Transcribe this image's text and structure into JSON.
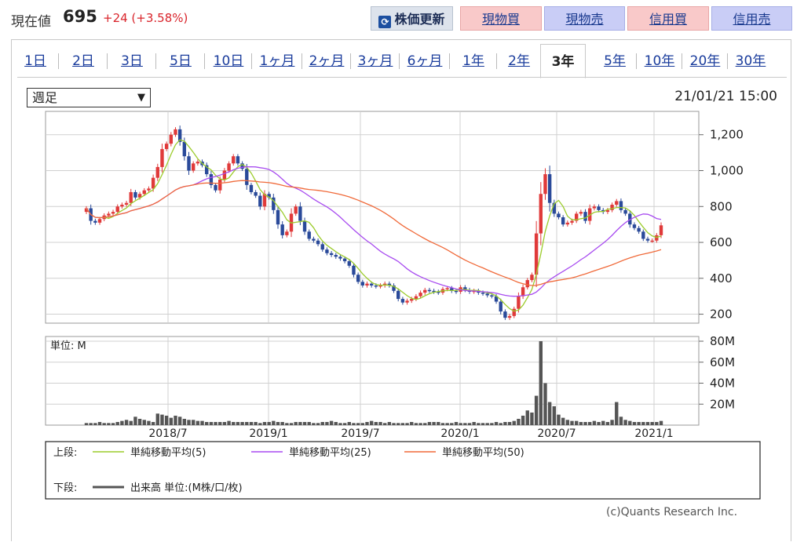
{
  "header": {
    "price_label": "現在値",
    "price_value": "695",
    "price_change": "+24 (+3.58%)",
    "refresh_label": "株価更新",
    "buttons": [
      "現物買",
      "現物売",
      "信用買",
      "信用売"
    ],
    "colors": {
      "up": "#d9242b",
      "buy_bg": "#f9c9c9",
      "sell_bg": "#c9cdf6"
    }
  },
  "tabs": [
    "1日",
    "2日",
    "3日",
    "5日",
    "10日",
    "1ヶ月",
    "2ヶ月",
    "3ヶ月",
    "6ヶ月",
    "1年",
    "2年",
    "3年",
    "5年",
    "10年",
    "20年",
    "30年"
  ],
  "active_tab": "3年",
  "controls": {
    "period_select": "週足",
    "datetime": "21/01/21 15:00"
  },
  "chart_data": {
    "type": "candlestick",
    "x_tick_labels": [
      "2018/7",
      "2019/1",
      "2019/7",
      "2020/1",
      "2020/7",
      "2021/1"
    ],
    "price_axis": {
      "ticks": [
        "200",
        "400",
        "600",
        "800",
        "1,000",
        "1,200"
      ],
      "range": [
        150,
        1330
      ]
    },
    "volume_axis": {
      "ticks": [
        "20M",
        "40M",
        "60M",
        "80M"
      ],
      "range": [
        0,
        80
      ],
      "unit_label": "単位: M"
    },
    "price_series_close": [
      790,
      720,
      710,
      730,
      750,
      760,
      770,
      800,
      810,
      820,
      880,
      850,
      870,
      890,
      900,
      960,
      1020,
      1120,
      1150,
      1200,
      1230,
      1160,
      1080,
      1000,
      1040,
      1050,
      1030,
      980,
      920,
      890,
      950,
      1000,
      1040,
      1080,
      1040,
      1010,
      920,
      880,
      860,
      800,
      870,
      850,
      780,
      700,
      640,
      660,
      760,
      800,
      720,
      660,
      620,
      610,
      590,
      560,
      540,
      530,
      520,
      510,
      495,
      470,
      420,
      380,
      360,
      370,
      360,
      355,
      360,
      370,
      360,
      330,
      285,
      265,
      275,
      285,
      300,
      320,
      335,
      330,
      325,
      320,
      340,
      345,
      330,
      325,
      350,
      335,
      325,
      330,
      320,
      315,
      305,
      300,
      270,
      215,
      180,
      190,
      230,
      300,
      350,
      390,
      420,
      650,
      870,
      980,
      820,
      760,
      740,
      700,
      710,
      720,
      760,
      770,
      720,
      790,
      800,
      780,
      770,
      780,
      810,
      830,
      780,
      760,
      700,
      680,
      660,
      620,
      610,
      610,
      640,
      695
    ],
    "ma_legend": [
      "単純移動平均(5)",
      "単純移動平均(25)",
      "単純移動平均(50)"
    ],
    "ma_colors": [
      "#9ccc2c",
      "#a84cf0",
      "#f06a3a"
    ],
    "volume_legend": "出来高 単位:(M株/口/枚)",
    "volume_values": [
      2,
      2,
      2,
      3,
      2,
      2,
      2,
      3,
      4,
      5,
      4,
      8,
      6,
      5,
      4,
      3,
      11,
      10,
      9,
      7,
      9,
      8,
      6,
      5,
      5,
      4,
      4,
      3,
      3,
      3,
      3,
      3,
      4,
      3,
      3,
      3,
      3,
      3,
      3,
      2,
      3,
      3,
      4,
      3,
      3,
      2,
      2,
      3,
      3,
      3,
      3,
      2,
      2,
      3,
      3,
      4,
      3,
      2,
      2,
      3,
      2,
      2,
      2,
      3,
      4,
      3,
      3,
      2,
      3,
      2,
      2,
      2,
      2,
      3,
      2,
      2,
      2,
      3,
      3,
      3,
      2,
      2,
      2,
      3,
      2,
      2,
      2,
      3,
      2,
      2,
      2,
      2,
      3,
      2,
      3,
      3,
      4,
      6,
      9,
      14,
      12,
      28,
      80,
      40,
      22,
      18,
      10,
      7,
      5,
      4,
      4,
      3,
      3,
      3,
      4,
      3,
      4,
      3,
      5,
      22,
      8,
      5,
      4,
      3,
      3,
      3,
      3,
      3,
      3,
      4,
      5
    ],
    "row_labels": {
      "upper": "上段:",
      "lower": "下段:"
    }
  },
  "copyright": "(c)Quants Research Inc."
}
